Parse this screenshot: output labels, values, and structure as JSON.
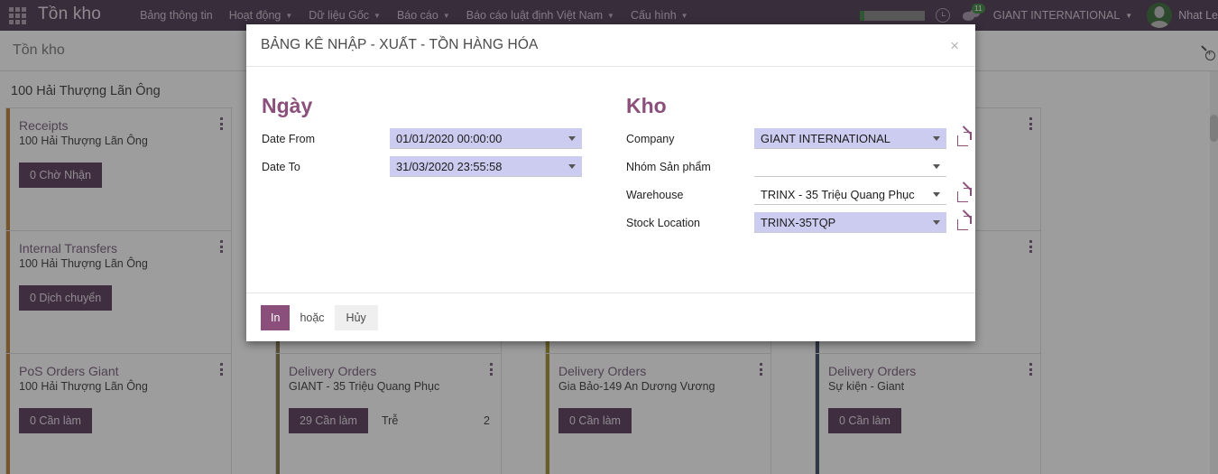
{
  "navbar": {
    "apps_icon": "grid-apps-icon",
    "brand": "Tồn kho",
    "menu": [
      {
        "label": "Bảng thông tin",
        "caret": false
      },
      {
        "label": "Hoạt động",
        "caret": true
      },
      {
        "label": "Dữ liệu Gốc",
        "caret": true
      },
      {
        "label": "Báo cáo",
        "caret": true
      },
      {
        "label": "Báo cáo luật định Việt Nam",
        "caret": true
      },
      {
        "label": "Cấu hình",
        "caret": true
      }
    ],
    "progress_icon": "progress-bar",
    "clock_icon": "clock-icon",
    "chat_icon": "chat-bubble-icon",
    "chat_badge": "11",
    "company": "GIANT INTERNATIONAL",
    "avatar_icon": "user-avatar",
    "username": "Nhat Le"
  },
  "control_panel": {
    "breadcrumb": "Tồn kho",
    "search_icon": "search-zoom-icon"
  },
  "kanban": {
    "group_title": "100 Hải Thượng Lãn Ông",
    "columns": [
      {
        "stripe": "#b5742a",
        "cards": [
          {
            "title": "Receipts",
            "subtitle": "100 Hải Thượng Lãn Ông",
            "button": "0 Chờ Nhận",
            "extra_label": "",
            "extra_value": ""
          },
          {
            "title": "Internal Transfers",
            "subtitle": "100 Hải Thượng Lãn Ông",
            "button": "0 Dịch chuyển",
            "extra_label": "",
            "extra_value": ""
          },
          {
            "title": "PoS Orders Giant",
            "subtitle": "100 Hải Thượng Lãn Ông",
            "button": "0 Cần làm",
            "extra_label": "",
            "extra_value": ""
          }
        ]
      },
      {
        "stripe": "#7e6b3f",
        "cards": [
          {
            "title": "",
            "subtitle": "",
            "button": "",
            "extra_label": "",
            "extra_value": ""
          },
          {
            "title": "",
            "subtitle": "",
            "button": "",
            "extra_label": "",
            "extra_value": ""
          },
          {
            "title": "Delivery Orders",
            "subtitle": "GIANT - 35 Triệu Quang Phục",
            "button": "29 Cần làm",
            "extra_label": "Trễ",
            "extra_value": "2"
          }
        ]
      },
      {
        "stripe": "#9a8a14",
        "cards": [
          {
            "title": "",
            "subtitle": "",
            "button": "",
            "extra_label": "",
            "extra_value": ""
          },
          {
            "title": "",
            "subtitle": "",
            "button": "",
            "extra_label": "",
            "extra_value": ""
          },
          {
            "title": "Delivery Orders",
            "subtitle": "Gia Bảo-149 An Dương Vương",
            "button": "0 Cần làm",
            "extra_label": "",
            "extra_value": ""
          }
        ]
      },
      {
        "stripe": "#2e3b55",
        "cards": [
          {
            "title": "",
            "subtitle": "",
            "button": "",
            "extra_label": "",
            "extra_value": ""
          },
          {
            "title": "",
            "subtitle": "",
            "button": "",
            "extra_label": "",
            "extra_value": ""
          },
          {
            "title": "Delivery Orders",
            "subtitle": "Sự kiện - Giant",
            "button": "0 Cần làm",
            "extra_label": "",
            "extra_value": ""
          }
        ]
      }
    ]
  },
  "modal": {
    "title": "BẢNG KÊ NHẬP - XUẤT - TỒN HÀNG HÓA",
    "close_icon": "close-x-icon",
    "left": {
      "legend": "Ngày",
      "fields": [
        {
          "label": "Date From",
          "value": "01/01/2020 00:00:00",
          "filled": true
        },
        {
          "label": "Date To",
          "value": "31/03/2020 23:55:58",
          "filled": true
        }
      ]
    },
    "right": {
      "legend": "Kho",
      "fields": [
        {
          "label": "Company",
          "value": "GIANT INTERNATIONAL",
          "filled": true,
          "ext": true
        },
        {
          "label": "Nhóm Sản phẩm",
          "value": "",
          "filled": false,
          "ext": false
        },
        {
          "label": "Warehouse",
          "value": "TRINX - 35 Triệu Quang Phục",
          "filled": false,
          "ext": true
        },
        {
          "label": "Stock Location",
          "value": "TRINX-35TQP",
          "filled": true,
          "ext": true
        }
      ]
    },
    "footer": {
      "print_label": "In",
      "or_label": "hoặc",
      "cancel_label": "Hủy"
    }
  },
  "colors": {
    "navbar_bg": "#3f2a42",
    "accent": "#8b4f7c",
    "field_filled": "#ccccf0",
    "kanban_btn": "#4a2b4c"
  }
}
